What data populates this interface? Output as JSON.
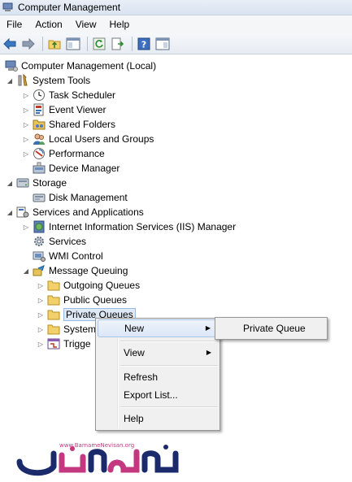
{
  "window": {
    "title": "Computer Management"
  },
  "menubar": {
    "items": [
      "File",
      "Action",
      "View",
      "Help"
    ]
  },
  "tree": {
    "root": "Computer Management (Local)",
    "system_tools": "System Tools",
    "task_scheduler": "Task Scheduler",
    "event_viewer": "Event Viewer",
    "shared_folders": "Shared Folders",
    "local_users": "Local Users and Groups",
    "performance": "Performance",
    "device_manager": "Device Manager",
    "storage": "Storage",
    "disk_management": "Disk Management",
    "services_apps": "Services and Applications",
    "iis_manager": "Internet Information Services (IIS) Manager",
    "services": "Services",
    "wmi_control": "WMI Control",
    "message_queuing": "Message Queuing",
    "outgoing_queues": "Outgoing Queues",
    "public_queues": "Public Queues",
    "private_queues": "Private Queues",
    "system_queues": "System",
    "triggers": "Trigge"
  },
  "context_menu": {
    "new": "New",
    "view": "View",
    "refresh": "Refresh",
    "export_list": "Export List...",
    "help": "Help"
  },
  "submenu": {
    "private_queue": "Private Queue"
  },
  "watermark": {
    "url": "www.BarnameNevisan.org",
    "text": "برنامه نویسان"
  },
  "colors": {
    "selection": "#dfe9f6",
    "menu_bg": "#f0f0f0",
    "logo": "#c3387e",
    "logo_dark": "#1b2a6b"
  }
}
